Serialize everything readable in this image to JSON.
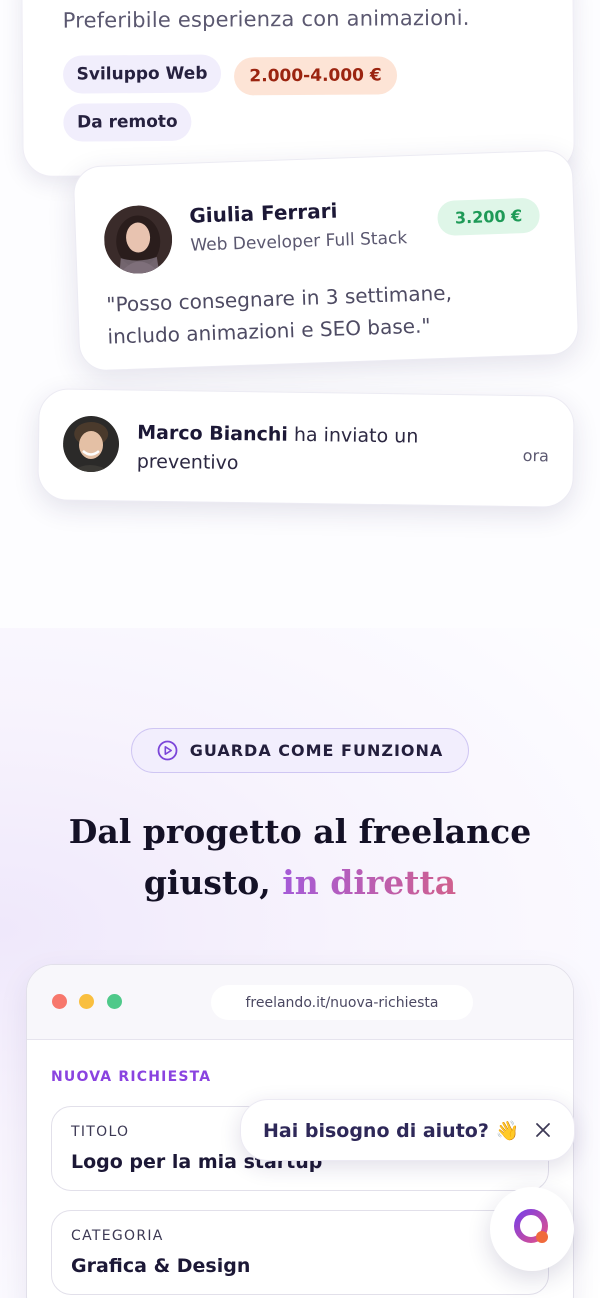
{
  "job_card": {
    "description": "Preferibile esperienza con animazioni.",
    "tags": [
      "Sviluppo Web",
      "2.000-4.000 €",
      "Da remoto"
    ]
  },
  "proposal": {
    "name": "Giulia Ferrari",
    "role": "Web Developer Full Stack",
    "price": "3.200 €",
    "quote_line1": "\"Posso consegnare in 3 settimane,",
    "quote_line2": "includo animazioni e SEO base.\""
  },
  "notification": {
    "sender": "Marco Bianchi",
    "message": "ha inviato un preventivo",
    "time": "ora"
  },
  "section": {
    "pill_label": "GUARDA COME FUNZIONA",
    "heading_line1": "Dal progetto al freelance",
    "heading_line2_plain": "giusto,",
    "heading_line2_accent": "in diretta"
  },
  "browser": {
    "url": "freelando.it/nuova-richiesta",
    "dot_colors": [
      "#f7776c",
      "#f9bf3f",
      "#4fc98a"
    ],
    "form_title": "NUOVA RICHIESTA",
    "fields": [
      {
        "label": "TITOLO",
        "value": "Logo per la mia startup"
      },
      {
        "label": "CATEGORIA",
        "value": "Grafica & Design"
      }
    ]
  },
  "help_bubble": {
    "text": "Hai bisogno di aiuto? 👋",
    "close_icon": "close-icon"
  },
  "launcher": {
    "icon": "chat-logo-icon"
  },
  "colors": {
    "accent_purple": "#8a43e0",
    "accent_pink": "#d0608d",
    "price_green": "#1e9a57",
    "tag_peach_text": "#9b2410"
  }
}
